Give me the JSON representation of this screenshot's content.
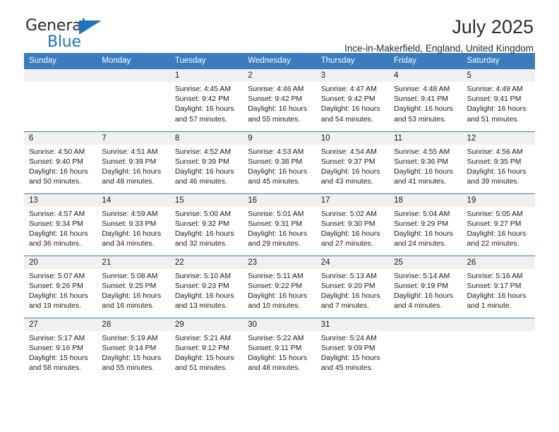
{
  "brand": {
    "name_top": "General",
    "name_bottom": "Blue",
    "flag_icon": "triangle-flag-icon",
    "color_blue": "#1b76bc"
  },
  "header": {
    "title": "July 2025",
    "subtitle": "Ince-in-Makerfield, England, United Kingdom"
  },
  "calendar": {
    "header_bg": "#3a7cbe",
    "daynum_bg": "#f0f0f0",
    "weekdays": [
      "Sunday",
      "Monday",
      "Tuesday",
      "Wednesday",
      "Thursday",
      "Friday",
      "Saturday"
    ],
    "weeks": [
      [
        {
          "day": "",
          "sunrise": "",
          "sunset": "",
          "daylight_line1": "",
          "daylight_line2": ""
        },
        {
          "day": "",
          "sunrise": "",
          "sunset": "",
          "daylight_line1": "",
          "daylight_line2": ""
        },
        {
          "day": "1",
          "sunrise": "Sunrise: 4:45 AM",
          "sunset": "Sunset: 9:42 PM",
          "daylight_line1": "Daylight: 16 hours",
          "daylight_line2": "and 57 minutes."
        },
        {
          "day": "2",
          "sunrise": "Sunrise: 4:46 AM",
          "sunset": "Sunset: 9:42 PM",
          "daylight_line1": "Daylight: 16 hours",
          "daylight_line2": "and 55 minutes."
        },
        {
          "day": "3",
          "sunrise": "Sunrise: 4:47 AM",
          "sunset": "Sunset: 9:42 PM",
          "daylight_line1": "Daylight: 16 hours",
          "daylight_line2": "and 54 minutes."
        },
        {
          "day": "4",
          "sunrise": "Sunrise: 4:48 AM",
          "sunset": "Sunset: 9:41 PM",
          "daylight_line1": "Daylight: 16 hours",
          "daylight_line2": "and 53 minutes."
        },
        {
          "day": "5",
          "sunrise": "Sunrise: 4:49 AM",
          "sunset": "Sunset: 9:41 PM",
          "daylight_line1": "Daylight: 16 hours",
          "daylight_line2": "and 51 minutes."
        }
      ],
      [
        {
          "day": "6",
          "sunrise": "Sunrise: 4:50 AM",
          "sunset": "Sunset: 9:40 PM",
          "daylight_line1": "Daylight: 16 hours",
          "daylight_line2": "and 50 minutes."
        },
        {
          "day": "7",
          "sunrise": "Sunrise: 4:51 AM",
          "sunset": "Sunset: 9:39 PM",
          "daylight_line1": "Daylight: 16 hours",
          "daylight_line2": "and 48 minutes."
        },
        {
          "day": "8",
          "sunrise": "Sunrise: 4:52 AM",
          "sunset": "Sunset: 9:39 PM",
          "daylight_line1": "Daylight: 16 hours",
          "daylight_line2": "and 46 minutes."
        },
        {
          "day": "9",
          "sunrise": "Sunrise: 4:53 AM",
          "sunset": "Sunset: 9:38 PM",
          "daylight_line1": "Daylight: 16 hours",
          "daylight_line2": "and 45 minutes."
        },
        {
          "day": "10",
          "sunrise": "Sunrise: 4:54 AM",
          "sunset": "Sunset: 9:37 PM",
          "daylight_line1": "Daylight: 16 hours",
          "daylight_line2": "and 43 minutes."
        },
        {
          "day": "11",
          "sunrise": "Sunrise: 4:55 AM",
          "sunset": "Sunset: 9:36 PM",
          "daylight_line1": "Daylight: 16 hours",
          "daylight_line2": "and 41 minutes."
        },
        {
          "day": "12",
          "sunrise": "Sunrise: 4:56 AM",
          "sunset": "Sunset: 9:35 PM",
          "daylight_line1": "Daylight: 16 hours",
          "daylight_line2": "and 39 minutes."
        }
      ],
      [
        {
          "day": "13",
          "sunrise": "Sunrise: 4:57 AM",
          "sunset": "Sunset: 9:34 PM",
          "daylight_line1": "Daylight: 16 hours",
          "daylight_line2": "and 36 minutes."
        },
        {
          "day": "14",
          "sunrise": "Sunrise: 4:59 AM",
          "sunset": "Sunset: 9:33 PM",
          "daylight_line1": "Daylight: 16 hours",
          "daylight_line2": "and 34 minutes."
        },
        {
          "day": "15",
          "sunrise": "Sunrise: 5:00 AM",
          "sunset": "Sunset: 9:32 PM",
          "daylight_line1": "Daylight: 16 hours",
          "daylight_line2": "and 32 minutes."
        },
        {
          "day": "16",
          "sunrise": "Sunrise: 5:01 AM",
          "sunset": "Sunset: 9:31 PM",
          "daylight_line1": "Daylight: 16 hours",
          "daylight_line2": "and 29 minutes."
        },
        {
          "day": "17",
          "sunrise": "Sunrise: 5:02 AM",
          "sunset": "Sunset: 9:30 PM",
          "daylight_line1": "Daylight: 16 hours",
          "daylight_line2": "and 27 minutes."
        },
        {
          "day": "18",
          "sunrise": "Sunrise: 5:04 AM",
          "sunset": "Sunset: 9:29 PM",
          "daylight_line1": "Daylight: 16 hours",
          "daylight_line2": "and 24 minutes."
        },
        {
          "day": "19",
          "sunrise": "Sunrise: 5:05 AM",
          "sunset": "Sunset: 9:27 PM",
          "daylight_line1": "Daylight: 16 hours",
          "daylight_line2": "and 22 minutes."
        }
      ],
      [
        {
          "day": "20",
          "sunrise": "Sunrise: 5:07 AM",
          "sunset": "Sunset: 9:26 PM",
          "daylight_line1": "Daylight: 16 hours",
          "daylight_line2": "and 19 minutes."
        },
        {
          "day": "21",
          "sunrise": "Sunrise: 5:08 AM",
          "sunset": "Sunset: 9:25 PM",
          "daylight_line1": "Daylight: 16 hours",
          "daylight_line2": "and 16 minutes."
        },
        {
          "day": "22",
          "sunrise": "Sunrise: 5:10 AM",
          "sunset": "Sunset: 9:23 PM",
          "daylight_line1": "Daylight: 16 hours",
          "daylight_line2": "and 13 minutes."
        },
        {
          "day": "23",
          "sunrise": "Sunrise: 5:11 AM",
          "sunset": "Sunset: 9:22 PM",
          "daylight_line1": "Daylight: 16 hours",
          "daylight_line2": "and 10 minutes."
        },
        {
          "day": "24",
          "sunrise": "Sunrise: 5:13 AM",
          "sunset": "Sunset: 9:20 PM",
          "daylight_line1": "Daylight: 16 hours",
          "daylight_line2": "and 7 minutes."
        },
        {
          "day": "25",
          "sunrise": "Sunrise: 5:14 AM",
          "sunset": "Sunset: 9:19 PM",
          "daylight_line1": "Daylight: 16 hours",
          "daylight_line2": "and 4 minutes."
        },
        {
          "day": "26",
          "sunrise": "Sunrise: 5:16 AM",
          "sunset": "Sunset: 9:17 PM",
          "daylight_line1": "Daylight: 16 hours",
          "daylight_line2": "and 1 minute."
        }
      ],
      [
        {
          "day": "27",
          "sunrise": "Sunrise: 5:17 AM",
          "sunset": "Sunset: 9:16 PM",
          "daylight_line1": "Daylight: 15 hours",
          "daylight_line2": "and 58 minutes."
        },
        {
          "day": "28",
          "sunrise": "Sunrise: 5:19 AM",
          "sunset": "Sunset: 9:14 PM",
          "daylight_line1": "Daylight: 15 hours",
          "daylight_line2": "and 55 minutes."
        },
        {
          "day": "29",
          "sunrise": "Sunrise: 5:21 AM",
          "sunset": "Sunset: 9:12 PM",
          "daylight_line1": "Daylight: 15 hours",
          "daylight_line2": "and 51 minutes."
        },
        {
          "day": "30",
          "sunrise": "Sunrise: 5:22 AM",
          "sunset": "Sunset: 9:11 PM",
          "daylight_line1": "Daylight: 15 hours",
          "daylight_line2": "and 48 minutes."
        },
        {
          "day": "31",
          "sunrise": "Sunrise: 5:24 AM",
          "sunset": "Sunset: 9:09 PM",
          "daylight_line1": "Daylight: 15 hours",
          "daylight_line2": "and 45 minutes."
        },
        {
          "day": "",
          "sunrise": "",
          "sunset": "",
          "daylight_line1": "",
          "daylight_line2": ""
        },
        {
          "day": "",
          "sunrise": "",
          "sunset": "",
          "daylight_line1": "",
          "daylight_line2": ""
        }
      ]
    ]
  }
}
